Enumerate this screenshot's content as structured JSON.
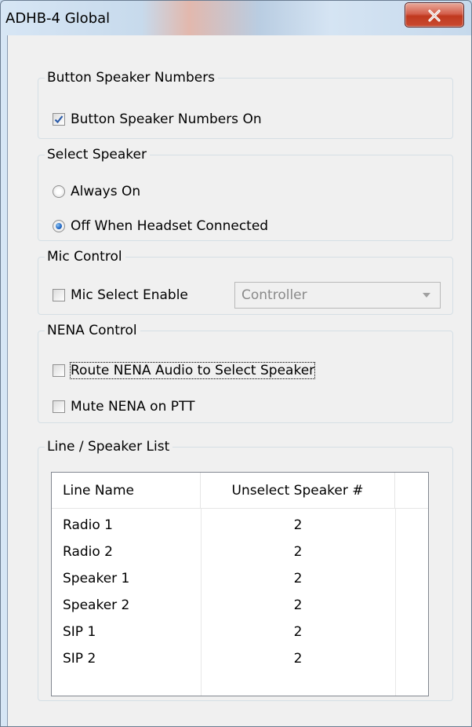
{
  "window": {
    "title": "ADHB-4 Global"
  },
  "groups": {
    "button_speaker": {
      "legend": "Button Speaker Numbers",
      "checkbox_label": "Button Speaker Numbers On",
      "checked": true
    },
    "select_speaker": {
      "legend": "Select Speaker",
      "options": [
        "Always On",
        "Off When Headset Connected"
      ],
      "selected": "Off When Headset Connected"
    },
    "mic_control": {
      "legend": "Mic Control",
      "checkbox_label": "Mic Select Enable",
      "checked": false,
      "dropdown_value": "Controller"
    },
    "nena_control": {
      "legend": "NENA Control",
      "route_label": "Route NENA Audio to Select Speaker",
      "mute_label": "Mute NENA on PTT"
    },
    "line_list": {
      "legend": "Line / Speaker List",
      "columns": [
        "Line Name",
        "Unselect Speaker #"
      ],
      "rows": [
        {
          "name": "Radio 1",
          "speaker": "2"
        },
        {
          "name": "Radio 2",
          "speaker": "2"
        },
        {
          "name": "Speaker 1",
          "speaker": "2"
        },
        {
          "name": "Speaker 2",
          "speaker": "2"
        },
        {
          "name": "SIP 1",
          "speaker": "2"
        },
        {
          "name": "SIP 2",
          "speaker": "2"
        }
      ]
    }
  }
}
